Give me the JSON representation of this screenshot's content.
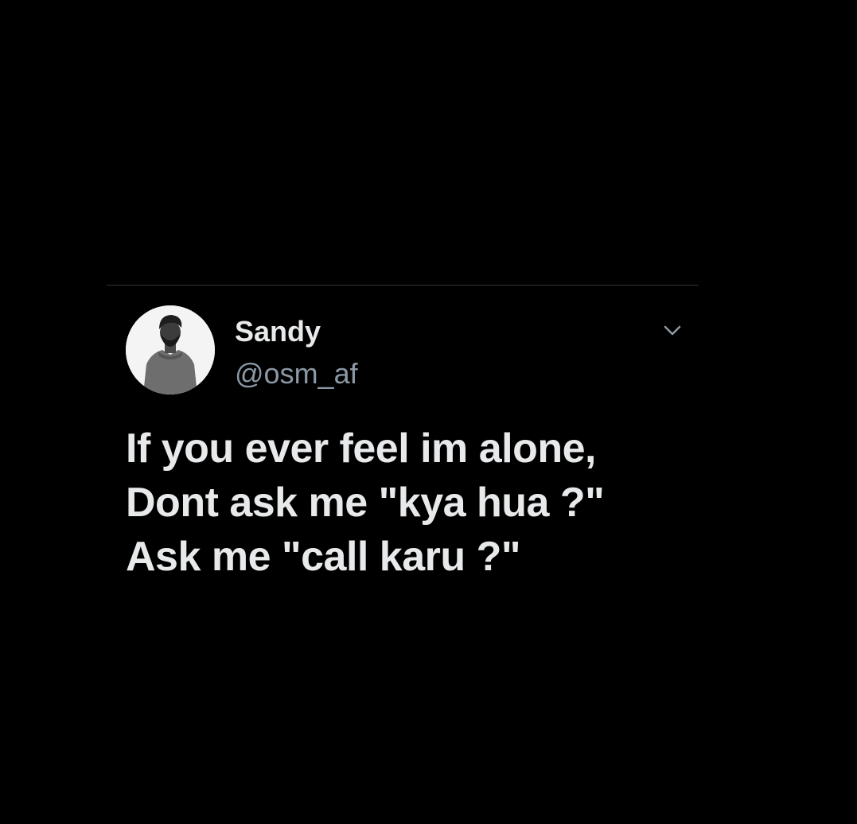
{
  "tweet": {
    "author": {
      "name": "Sandy",
      "handle": "@osm_af",
      "avatar_icon": "user-photo-icon"
    },
    "menu_icon": "chevron-down-icon",
    "text_lines": [
      "If you ever feel im alone,",
      "Dont ask me \"kya hua ?\"",
      "Ask me \"call karu ?\""
    ]
  },
  "colors": {
    "background": "#000000",
    "primary_text": "#e7e9ea",
    "secondary_text": "#8b98a5",
    "divider": "#2f3336"
  }
}
